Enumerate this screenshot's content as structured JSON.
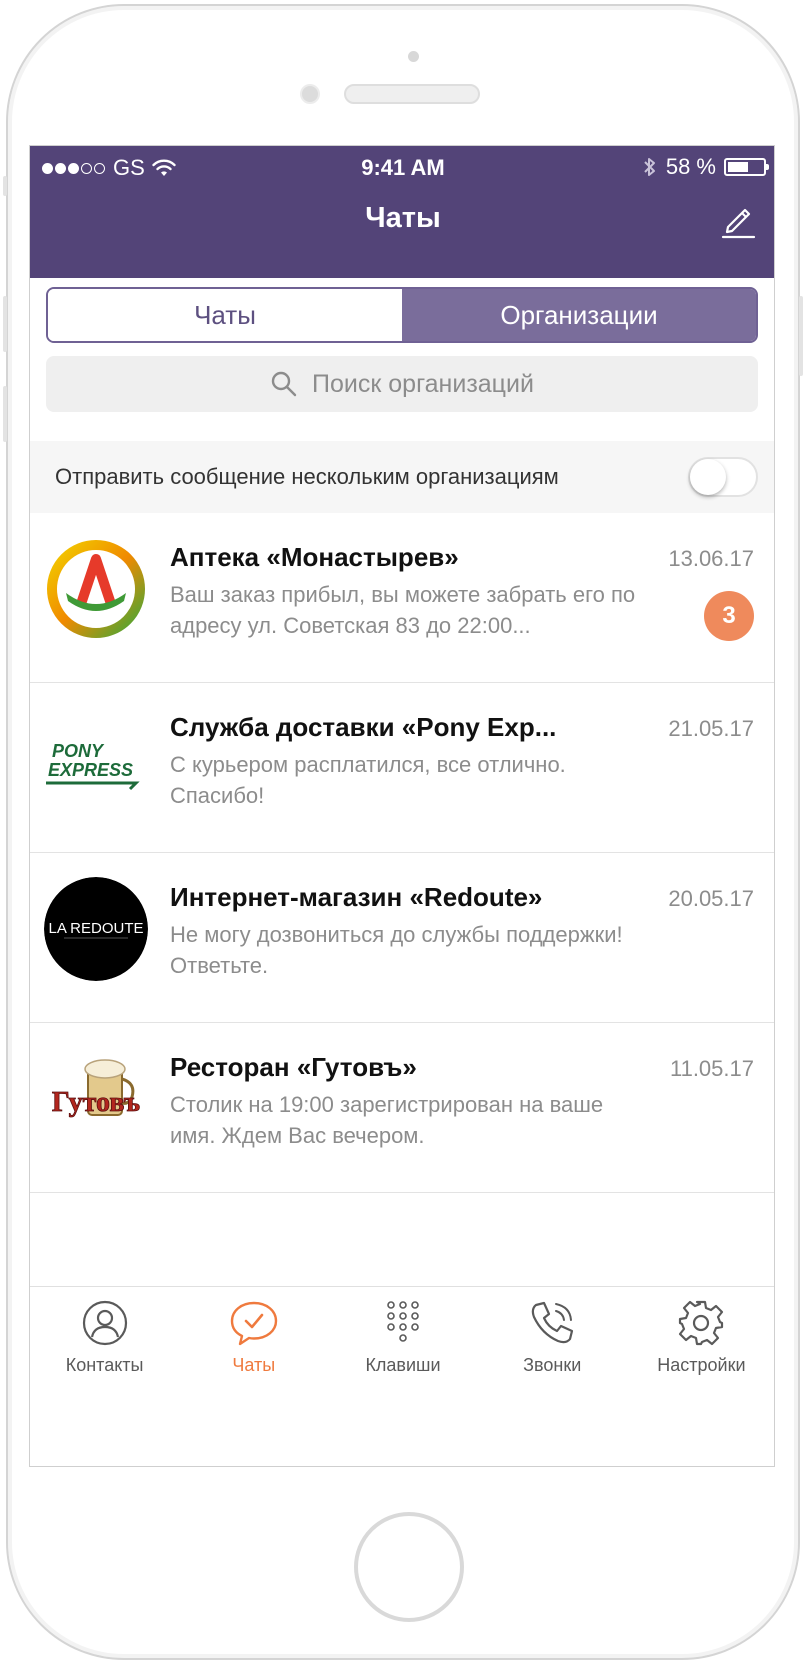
{
  "status_bar": {
    "carrier": "GS",
    "time": "9:41 AM",
    "battery": "58 %",
    "battery_level": 0.58,
    "signal_bars_filled": 3,
    "signal_bars_total": 5
  },
  "header": {
    "title": "Чаты"
  },
  "segments": {
    "chats_label": "Чаты",
    "orgs_label": "Организации",
    "selected": "Организации"
  },
  "search": {
    "placeholder": "Поиск организаций"
  },
  "broadcast": {
    "label": "Отправить сообщение нескольким организациям",
    "enabled": false
  },
  "chats": [
    {
      "name": "Аптека «Монастырев»",
      "date": "13.06.17",
      "message": "Ваш заказ прибыл, вы можете забрать его по адресу ул. Советская 83 до 22:00...",
      "unread": "3",
      "avatar_icon": "pharmacy-logo-icon"
    },
    {
      "name": "Служба доставки «Pony Exp...",
      "date": "21.05.17",
      "message": "С курьером расплатился, все отлично. Спасибо!",
      "avatar_icon": "pony-express-logo-icon",
      "logo_text_1": "PONY",
      "logo_text_2": "EXPRESS"
    },
    {
      "name": "Интернет-магазин «Redoute»",
      "date": "20.05.17",
      "message": "Не могу дозвониться до службы поддержки! Ответьте.",
      "avatar_icon": "la-redoute-logo-icon",
      "logo_text": "LA REDOUTE"
    },
    {
      "name": "Ресторан «Гутовъ»",
      "date": "11.05.17",
      "message": "Столик на 19:00 зарегистрирован на ваше имя. Ждем Вас вечером.",
      "avatar_icon": "gutov-logo-icon",
      "logo_text": "Гутовъ"
    }
  ],
  "tabbar": {
    "items": [
      {
        "label": "Контакты",
        "icon": "contacts-icon"
      },
      {
        "label": "Чаты",
        "icon": "chat-icon",
        "active": true
      },
      {
        "label": "Клавиши",
        "icon": "keypad-icon"
      },
      {
        "label": "Звонки",
        "icon": "phone-icon"
      },
      {
        "label": "Настройки",
        "icon": "gear-icon"
      }
    ]
  },
  "colors": {
    "header_bg": "#534478",
    "segment_active": "#7a6d9b",
    "accent_orange": "#ef7a3e",
    "badge": "#ef8a5c"
  }
}
